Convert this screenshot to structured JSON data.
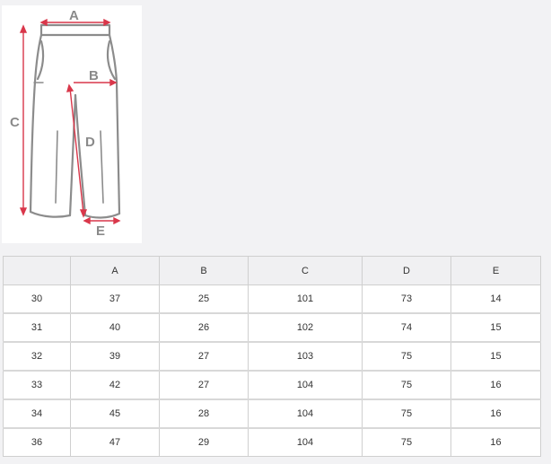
{
  "diagram": {
    "labels": {
      "a": "A",
      "b": "B",
      "c": "C",
      "d": "D",
      "e": "E"
    },
    "arrow_color": "#d9374a",
    "outline_color": "#8c8c8c"
  },
  "size_table": {
    "header": [
      "",
      "A",
      "B",
      "C",
      "D",
      "E"
    ],
    "rows": [
      [
        "30",
        "37",
        "25",
        "101",
        "73",
        "14"
      ],
      [
        "31",
        "40",
        "26",
        "102",
        "74",
        "15"
      ],
      [
        "32",
        "39",
        "27",
        "103",
        "75",
        "15"
      ],
      [
        "33",
        "42",
        "27",
        "104",
        "75",
        "16"
      ],
      [
        "34",
        "45",
        "28",
        "104",
        "75",
        "16"
      ],
      [
        "36",
        "47",
        "29",
        "104",
        "75",
        "16"
      ]
    ]
  }
}
